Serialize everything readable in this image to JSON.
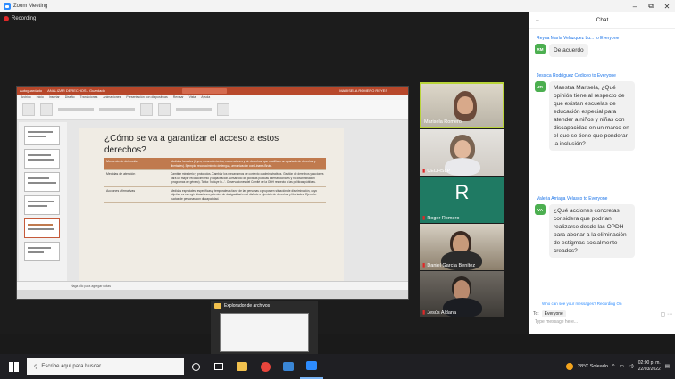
{
  "window": {
    "title": "Zoom Meeting",
    "controls": [
      "–",
      "⧉",
      "✕"
    ]
  },
  "recording": {
    "label": "Recording"
  },
  "ppt": {
    "title_left": "Autoguardado",
    "filename": "ANALIZAR DERECHOS - Guardado",
    "search": "Buscar",
    "user": "MARISELA ROMERO REYES",
    "tabs": [
      "Archivo",
      "Inicio",
      "Insertar",
      "Diseño",
      "Transiciones",
      "Animaciones",
      "Presentación con diapositivas",
      "Revisar",
      "Vista",
      "Ayuda"
    ],
    "slide_title": "¿Cómo se va a garantizar el acceso a estos derechos?",
    "table": [
      {
        "c1": "Momento de detección",
        "c2": "Medidas formales (leyes, reconocimientos, convenciones y sin derechos, que modifican un apartado de derechos y libertades). Ejemplo: reconocimiento de lengua, armonización con Linares Bruté."
      },
      {
        "c1": "Medidas de atención",
        "c2": "Cambiar ministerio y protocolos. Cambiar los mecanismos de contexto o administrativos. Gestión de derechos y acciones para un mayor reconocimiento y capacitación. Desarrollo de políticas públicas interseccionales y no discriminación (programas de género). Tabla: 'Incluye lo...'. Observaciones del Comité de la ODH respecto a las políticas públicas."
      },
      {
        "c1": "Acciones afirmativas",
        "c2": "Medidas especiales, específicas y temporales a favor de las personas o grupos en situación de discriminación, cuyo objetivo es corregir situaciones patentes de desigualdad en el disfrute o ejercicio de derechos y libertades. Ejemplo: cuotas de personas con discapacidad."
      }
    ],
    "status": "Haga clic para agregar notas"
  },
  "participants": [
    {
      "name": "Marisela Romero",
      "active": true
    },
    {
      "name": "CEDHSLP"
    },
    {
      "name": "Roger Romero",
      "initial": "R"
    },
    {
      "name": "Daniel García Benítez"
    },
    {
      "name": "Jesús Aldana"
    }
  ],
  "explorer": {
    "label": "Explorador de archivos"
  },
  "chat": {
    "title": "Chat",
    "messages": [
      {
        "from": "Reyna María Velázquez Lu... to Everyone",
        "initials": "RM",
        "color": "#4caf50",
        "text": "De acuerdo"
      },
      {
        "from": "Jessica Rodríguez Cediceo to Everyone",
        "initials": "JR",
        "color": "#4caf50",
        "text": "Maestra Marisela, ¿Qué opinión tiene al respecto de que existan escuelas de educación especial para atender a niños y niñas con discapacidad en un marco en el que se tiene que ponderar la inclusión?"
      },
      {
        "from": "Valeria Arriaga Velasco to Everyone",
        "initials": "VA",
        "color": "#4caf50",
        "text": "¿Qué acciones concretas considera que podrían realizarse desde las OPDH para abonar a la eliminación de estigmas socialmente creados?"
      }
    ],
    "note": "Who can see your messages? Recording On",
    "to_label": "To:",
    "to_value": "Everyone",
    "placeholder": "Type message here..."
  },
  "taskbar": {
    "search_placeholder": "Escribe aquí para buscar",
    "weather": "28°C Soleado",
    "time": "02:00 p. m.",
    "date": "22/03/2022"
  }
}
